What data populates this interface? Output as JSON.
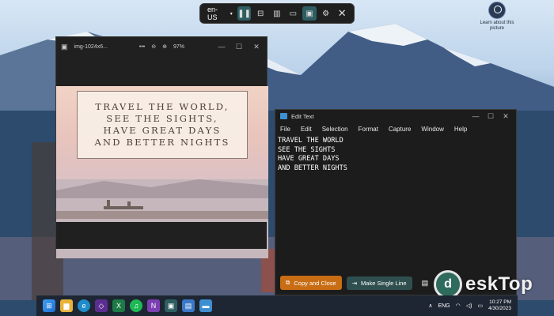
{
  "desktop": {
    "icon_label": "Learn about this picture"
  },
  "floating_toolbar": {
    "language": "en-US"
  },
  "viewer": {
    "filename": "img-1024x6...",
    "zoom": "97%",
    "quote_lines": [
      "TRAVEL THE WORLD,",
      "SEE THE SIGHTS,",
      "HAVE GREAT DAYS",
      "AND BETTER NIGHTS"
    ]
  },
  "editor": {
    "title": "Edit Text",
    "menu": [
      "File",
      "Edit",
      "Selection",
      "Format",
      "Capture",
      "Window",
      "Help"
    ],
    "lines": [
      "TRAVEL THE WORLD",
      "SEE THE SIGHTS",
      "HAVE GREAT DAYS",
      "AND BETTER NIGHTS"
    ],
    "copy_close_label": "Copy and Close",
    "single_line_label": "Make Single Line"
  },
  "watermark": {
    "text": "eskTop"
  },
  "taskbar": {
    "lang": "ENG",
    "time": "10:27 PM",
    "date": "4/30/2023"
  },
  "colors": {
    "accent_orange": "#c86d14",
    "accent_teal": "#2e5e62"
  }
}
